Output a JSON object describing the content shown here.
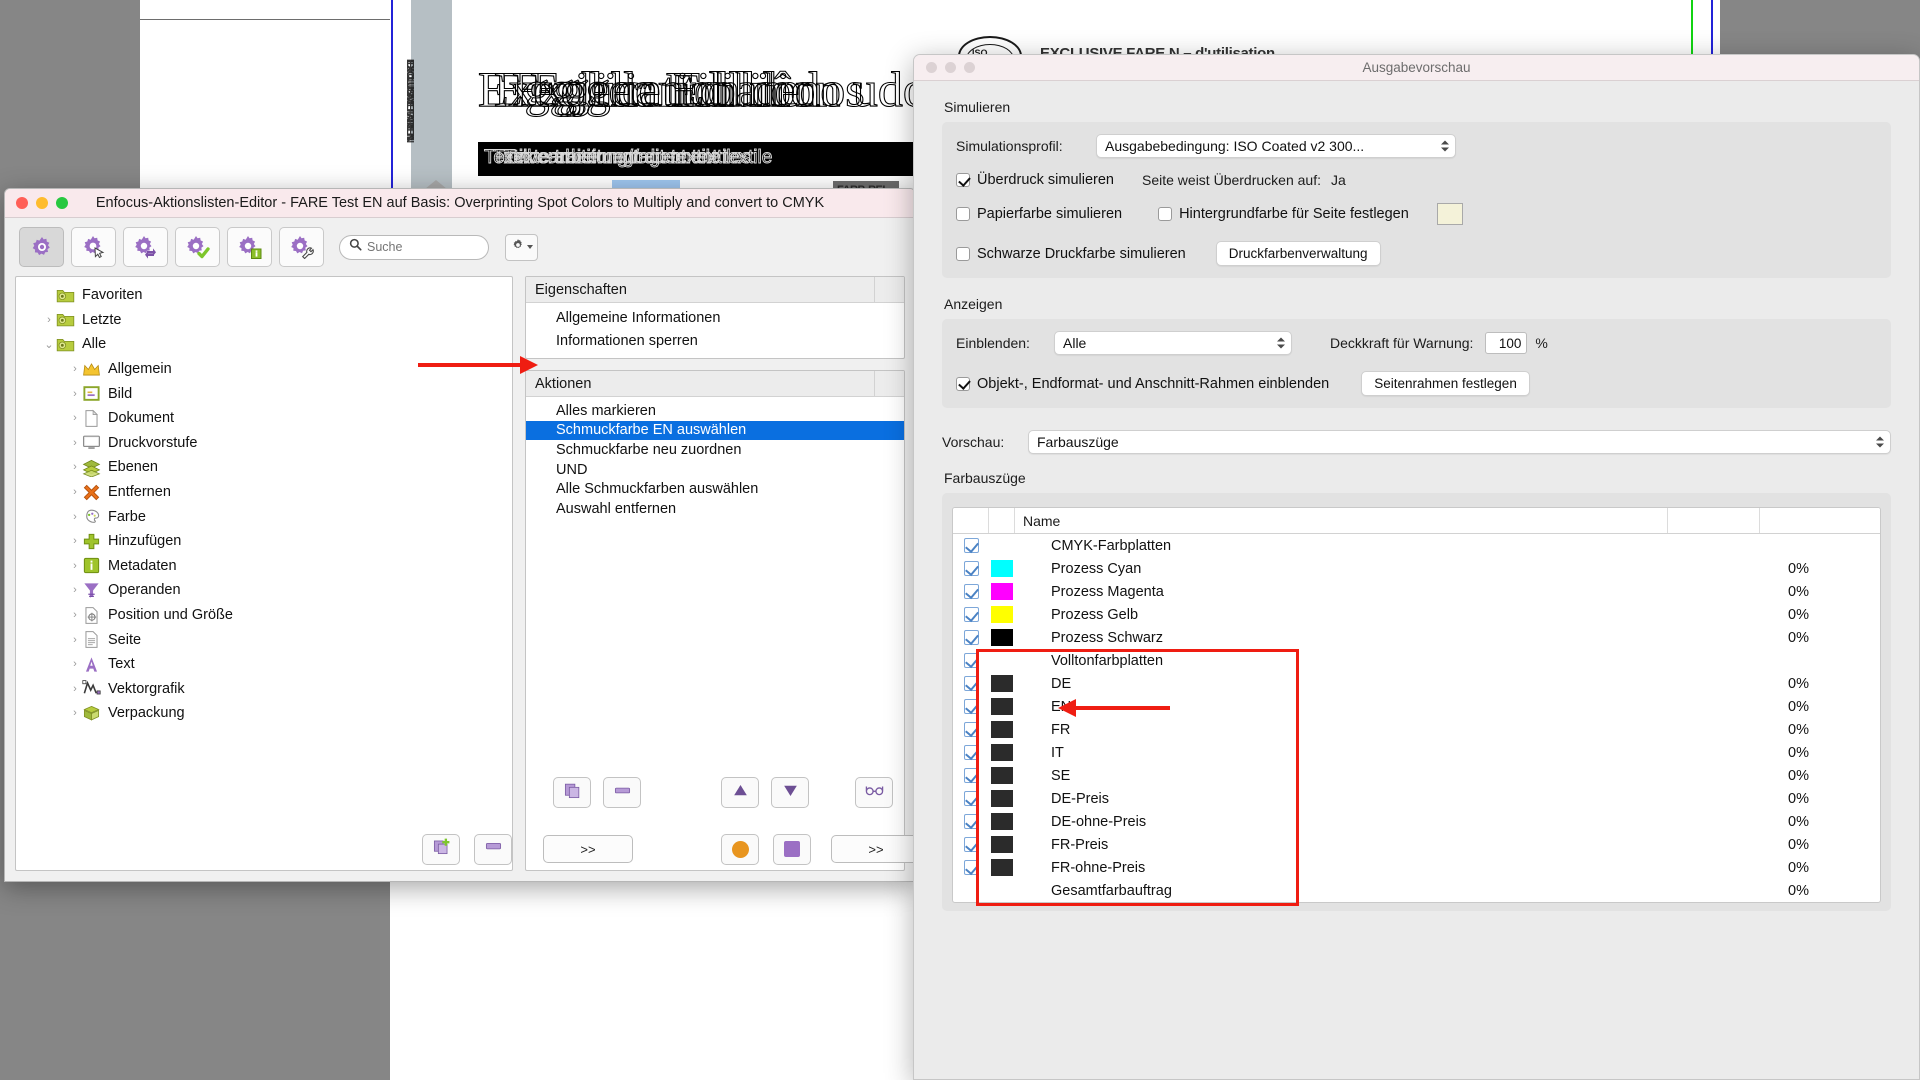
{
  "background_doc": {
    "vertical_text": "EXCLUSIVE FARE N",
    "headline_layers": [
      "Exegliec Edililion udog",
      "Eggjedantiban dos",
      "Fxglication de",
      "Eoglie Edlliôn"
    ],
    "blackbar_layers": [
      "Textilbearbeitung/traitement textile",
      "Textverarbeitung/agent textiles",
      "Texte traitement du textile"
    ],
    "stamp_label": "ISO",
    "doc_heading": "EXCLUSIVE FARE N – d'utilisation",
    "tab_button_label": "FARB-REI"
  },
  "enfocus_window": {
    "title": "Enfocus-Aktionslisten-Editor - FARE Test EN auf Basis: Overprinting Spot Colors to Multiply and convert to CMYK",
    "traffic_lights": [
      "close-red",
      "minimize-yellow",
      "zoom-green"
    ],
    "toolbar": {
      "buttons": [
        {
          "name": "action-gear",
          "icon": "gear-icon",
          "active": true
        },
        {
          "name": "action-select",
          "icon": "gear-cursor-icon",
          "active": false
        },
        {
          "name": "action-refresh",
          "icon": "gear-refresh-icon",
          "active": false
        },
        {
          "name": "action-check",
          "icon": "gear-check-icon",
          "active": false
        },
        {
          "name": "action-info",
          "icon": "gear-info-icon",
          "active": false
        },
        {
          "name": "action-wrench",
          "icon": "gear-wrench-icon",
          "active": false
        }
      ],
      "search_placeholder": "Suche",
      "search_value": "",
      "gear_menu_label": ""
    },
    "tree": [
      {
        "label": "Favoriten",
        "icon": "folder-gear-icon",
        "indent": 0,
        "twisty": "none"
      },
      {
        "label": "Letzte",
        "icon": "folder-gear-icon",
        "indent": 0,
        "twisty": "collapsed"
      },
      {
        "label": "Alle",
        "icon": "folder-gear-icon",
        "indent": 0,
        "twisty": "expanded"
      },
      {
        "label": "Allgemein",
        "icon": "crown-icon",
        "indent": 1,
        "twisty": "collapsed"
      },
      {
        "label": "Bild",
        "icon": "image-frame-icon",
        "indent": 1,
        "twisty": "collapsed"
      },
      {
        "label": "Dokument",
        "icon": "document-icon",
        "indent": 1,
        "twisty": "collapsed"
      },
      {
        "label": "Druckvorstufe",
        "icon": "monitor-icon",
        "indent": 1,
        "twisty": "collapsed"
      },
      {
        "label": "Ebenen",
        "icon": "layers-icon",
        "indent": 1,
        "twisty": "collapsed"
      },
      {
        "label": "Entfernen",
        "icon": "x-cross-icon",
        "indent": 1,
        "twisty": "collapsed"
      },
      {
        "label": "Farbe",
        "icon": "palette-icon",
        "indent": 1,
        "twisty": "collapsed"
      },
      {
        "label": "Hinzufügen",
        "icon": "plus-cross-icon",
        "indent": 1,
        "twisty": "collapsed"
      },
      {
        "label": "Metadaten",
        "icon": "info-square-icon",
        "indent": 1,
        "twisty": "collapsed"
      },
      {
        "label": "Operanden",
        "icon": "funnel-icon",
        "indent": 1,
        "twisty": "collapsed"
      },
      {
        "label": "Position und Größe",
        "icon": "position-icon",
        "indent": 1,
        "twisty": "collapsed"
      },
      {
        "label": "Seite",
        "icon": "page-lines-icon",
        "indent": 1,
        "twisty": "collapsed"
      },
      {
        "label": "Text",
        "icon": "letter-a-icon",
        "indent": 1,
        "twisty": "collapsed"
      },
      {
        "label": "Vektorgrafik",
        "icon": "vector-icon",
        "indent": 1,
        "twisty": "collapsed"
      },
      {
        "label": "Verpackung",
        "icon": "package-icon",
        "indent": 1,
        "twisty": "collapsed"
      }
    ],
    "properties": {
      "header": "Eigenschaften",
      "items": [
        "Allgemeine Informationen",
        "Informationen sperren"
      ]
    },
    "actions": {
      "header": "Aktionen",
      "items": [
        {
          "label": "Alles markieren",
          "selected": false
        },
        {
          "label": "Schmuckfarbe EN auswählen",
          "selected": true
        },
        {
          "label": "Schmuckfarbe neu zuordnen",
          "selected": false
        },
        {
          "label": "UND",
          "selected": false
        },
        {
          "label": "Alle Schmuckfarben auswählen",
          "selected": false
        },
        {
          "label": "Auswahl entfernen",
          "selected": false
        }
      ]
    },
    "bottom_buttons": {
      "add_action": "add-action-icon",
      "remove_action": "remove-action-icon",
      "move_up": "triangle-up-icon",
      "move_down": "triangle-down-icon",
      "glasses": "glasses-icon",
      "left_expand": ">>",
      "right_expand": ">>",
      "orange_circle": "orange-circle-icon",
      "purple_square": "purple-square-icon",
      "new_list": "new-list-icon",
      "settings_gear": "settings-gear-icon"
    }
  },
  "preview_window": {
    "title": "Ausgabevorschau",
    "simulate": {
      "section_label": "Simulieren",
      "profile_label": "Simulationsprofil:",
      "profile_value": "Ausgabebedingung: ISO Coated v2 300...",
      "overprint_label": "Überdruck simulieren",
      "overprint_checked": true,
      "page_overprint_label": "Seite weist Überdrucken auf:",
      "page_overprint_value": "Ja",
      "paper_color_label": "Papierfarbe simulieren",
      "paper_color_checked": false,
      "bg_color_label": "Hintergrundfarbe für Seite festlegen",
      "bg_color_checked": false,
      "bg_swatch_color": "#f4f2d9",
      "black_ink_label": "Schwarze Druckfarbe simulieren",
      "black_ink_checked": false,
      "ink_manager_button": "Druckfarbenverwaltung"
    },
    "display": {
      "section_label": "Anzeigen",
      "show_label": "Einblenden:",
      "show_value": "Alle",
      "opacity_label": "Deckkraft für Warnung:",
      "opacity_value": "100",
      "opacity_unit": "%",
      "frames_label": "Objekt-, Endformat- und Anschnitt-Rahmen einblenden",
      "frames_checked": true,
      "page_frames_button": "Seitenrahmen festlegen",
      "preview_label": "Vorschau:",
      "preview_value": "Farbauszüge"
    },
    "separations": {
      "section_label": "Farbauszüge",
      "columns": [
        "",
        "",
        "Name",
        "",
        ""
      ],
      "rows": [
        {
          "checked": true,
          "swatch": null,
          "name": "CMYK-Farbplatten",
          "pct": "",
          "group": true,
          "highlight": false
        },
        {
          "checked": true,
          "swatch": "#00ffff",
          "name": "Prozess Cyan",
          "pct": "0%",
          "group": false,
          "highlight": false
        },
        {
          "checked": true,
          "swatch": "#ff00ff",
          "name": "Prozess Magenta",
          "pct": "0%",
          "group": false,
          "highlight": false
        },
        {
          "checked": true,
          "swatch": "#ffff00",
          "name": "Prozess Gelb",
          "pct": "0%",
          "group": false,
          "highlight": false
        },
        {
          "checked": true,
          "swatch": "#000000",
          "name": "Prozess Schwarz",
          "pct": "0%",
          "group": false,
          "highlight": false
        },
        {
          "checked": true,
          "swatch": null,
          "name": "Volltonfarbplatten",
          "pct": "",
          "group": true,
          "highlight": true
        },
        {
          "checked": true,
          "swatch": "#2b2b2b",
          "name": "DE",
          "pct": "0%",
          "group": false,
          "highlight": true
        },
        {
          "checked": true,
          "swatch": "#2b2b2b",
          "name": "EN",
          "pct": "0%",
          "group": false,
          "highlight": true
        },
        {
          "checked": true,
          "swatch": "#2b2b2b",
          "name": "FR",
          "pct": "0%",
          "group": false,
          "highlight": true
        },
        {
          "checked": true,
          "swatch": "#2b2b2b",
          "name": "IT",
          "pct": "0%",
          "group": false,
          "highlight": true
        },
        {
          "checked": true,
          "swatch": "#2b2b2b",
          "name": "SE",
          "pct": "0%",
          "group": false,
          "highlight": true
        },
        {
          "checked": true,
          "swatch": "#2b2b2b",
          "name": "DE-Preis",
          "pct": "0%",
          "group": false,
          "highlight": true
        },
        {
          "checked": true,
          "swatch": "#2b2b2b",
          "name": "DE-ohne-Preis",
          "pct": "0%",
          "group": false,
          "highlight": true
        },
        {
          "checked": true,
          "swatch": "#2b2b2b",
          "name": "FR-Preis",
          "pct": "0%",
          "group": false,
          "highlight": true
        },
        {
          "checked": true,
          "swatch": "#2b2b2b",
          "name": "FR-ohne-Preis",
          "pct": "0%",
          "group": false,
          "highlight": true
        },
        {
          "checked": false,
          "swatch": null,
          "name": "Gesamtfarbauftrag",
          "pct": "0%",
          "group": true,
          "highlight": true
        }
      ]
    }
  },
  "annotations": {
    "arrow_color": "#ef1d12",
    "arrow_action_target": "Schmuckfarbe EN auswählen",
    "arrow_separation_target": "EN",
    "redbox_target": "Volltonfarbplatten group"
  }
}
